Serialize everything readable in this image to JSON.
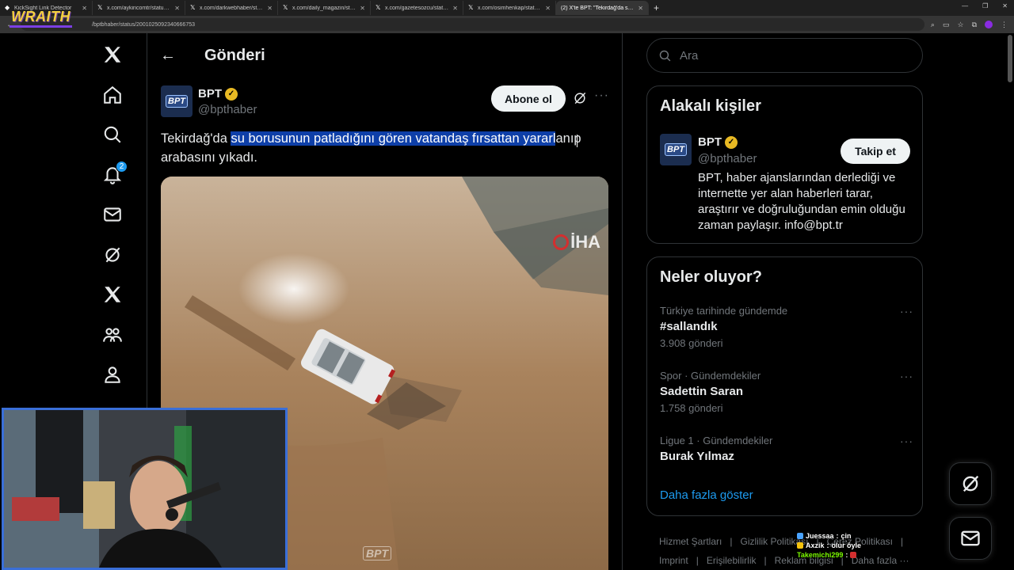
{
  "browser": {
    "tabs": [
      {
        "title": "KickSight Link Detector",
        "active": false
      },
      {
        "title": "x.com/aykiricomtr/status/2001...",
        "active": false
      },
      {
        "title": "x.com/darkwebhaber/status/20...",
        "active": false
      },
      {
        "title": "x.com/daily_magazin/status/20...",
        "active": false
      },
      {
        "title": "x.com/gazetesozcu/status/200...",
        "active": false
      },
      {
        "title": "x.com/osimhenkap/status/200...",
        "active": false
      },
      {
        "title": "(2) X'te BPT: \"Tekirdağ'da su bo...",
        "active": true
      }
    ],
    "url": "/bptbhaber/status/2001025092340666753"
  },
  "stream_logo": "WRAITH",
  "nav": {
    "notification_count": "2",
    "items": [
      "x-logo",
      "home",
      "explore",
      "notifications",
      "messages",
      "grok",
      "premium",
      "communities",
      "profile"
    ]
  },
  "header": {
    "title": "Gönderi"
  },
  "tweet": {
    "author_name": "BPT",
    "handle": "@bpthaber",
    "follow_label": "Abone ol",
    "avatar_text": "BPT",
    "text_before": "Tekirdağ'da ",
    "text_highlight": "su borusunun patladığını gören vatandaş fırsattan yararl",
    "text_after": "anıp arabasını yıkadı.",
    "media_watermark": "İHA",
    "media_watermark_bottom": "BPT"
  },
  "search": {
    "placeholder": "Ara"
  },
  "related": {
    "title": "Alakalı kişiler",
    "name": "BPT",
    "handle": "@bpthaber",
    "follow_label": "Takip et",
    "bio": "BPT, haber ajanslarından derlediği ve internette yer alan haberleri tarar, araştırır ve doğruluğundan emin olduğu zaman paylaşır. info@bpt.tr"
  },
  "trends": {
    "title": "Neler oluyor?",
    "items": [
      {
        "context": "Türkiye tarihinde gündemde",
        "name": "#sallandık",
        "count": "3.908 gönderi"
      },
      {
        "context": "Spor · Gündemdekiler",
        "name": "Sadettin Saran",
        "count": "1.758 gönderi"
      },
      {
        "context": "Ligue 1 · Gündemdekiler",
        "name": "Burak Yılmaz",
        "count": ""
      }
    ],
    "show_more": "Daha fazla göster"
  },
  "footer": {
    "line1": [
      "Hizmet Şartları",
      "|",
      "Gizlilik Politikası",
      "|",
      "Çerez Politikası",
      "|"
    ],
    "line2": [
      "Imprint",
      "|",
      "Erişilebilirlik",
      "|",
      "Reklam bilgisi",
      "|",
      "Daha fazla ···"
    ]
  },
  "chat": [
    {
      "user": "Juessaa",
      "msg": "çin"
    },
    {
      "user": "Axzik",
      "msg": "olur öyle"
    },
    {
      "user": "Takemichi299",
      "msg": ""
    }
  ],
  "colors": {
    "accent": "#1d9bf0",
    "highlight": "#0e3fa8",
    "verified": "#e8b923",
    "webcam_border": "#3a6fd8"
  }
}
